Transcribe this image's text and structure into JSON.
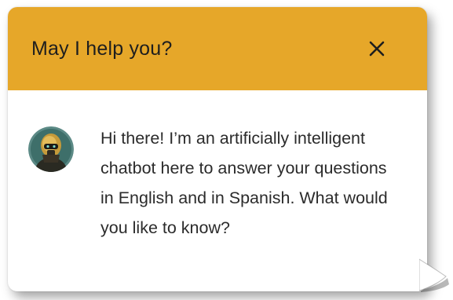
{
  "chat": {
    "title": "May I help you?",
    "message": "Hi there! I’m an artificially intelligent chatbot here to answer your questions in English and in Spanish. What would you like to know?"
  },
  "icons": {
    "close": "close-icon",
    "avatar": "robot-avatar"
  },
  "colors": {
    "header": "#e6a729",
    "title": "#1e1e1e",
    "text": "#2b2b2b"
  }
}
